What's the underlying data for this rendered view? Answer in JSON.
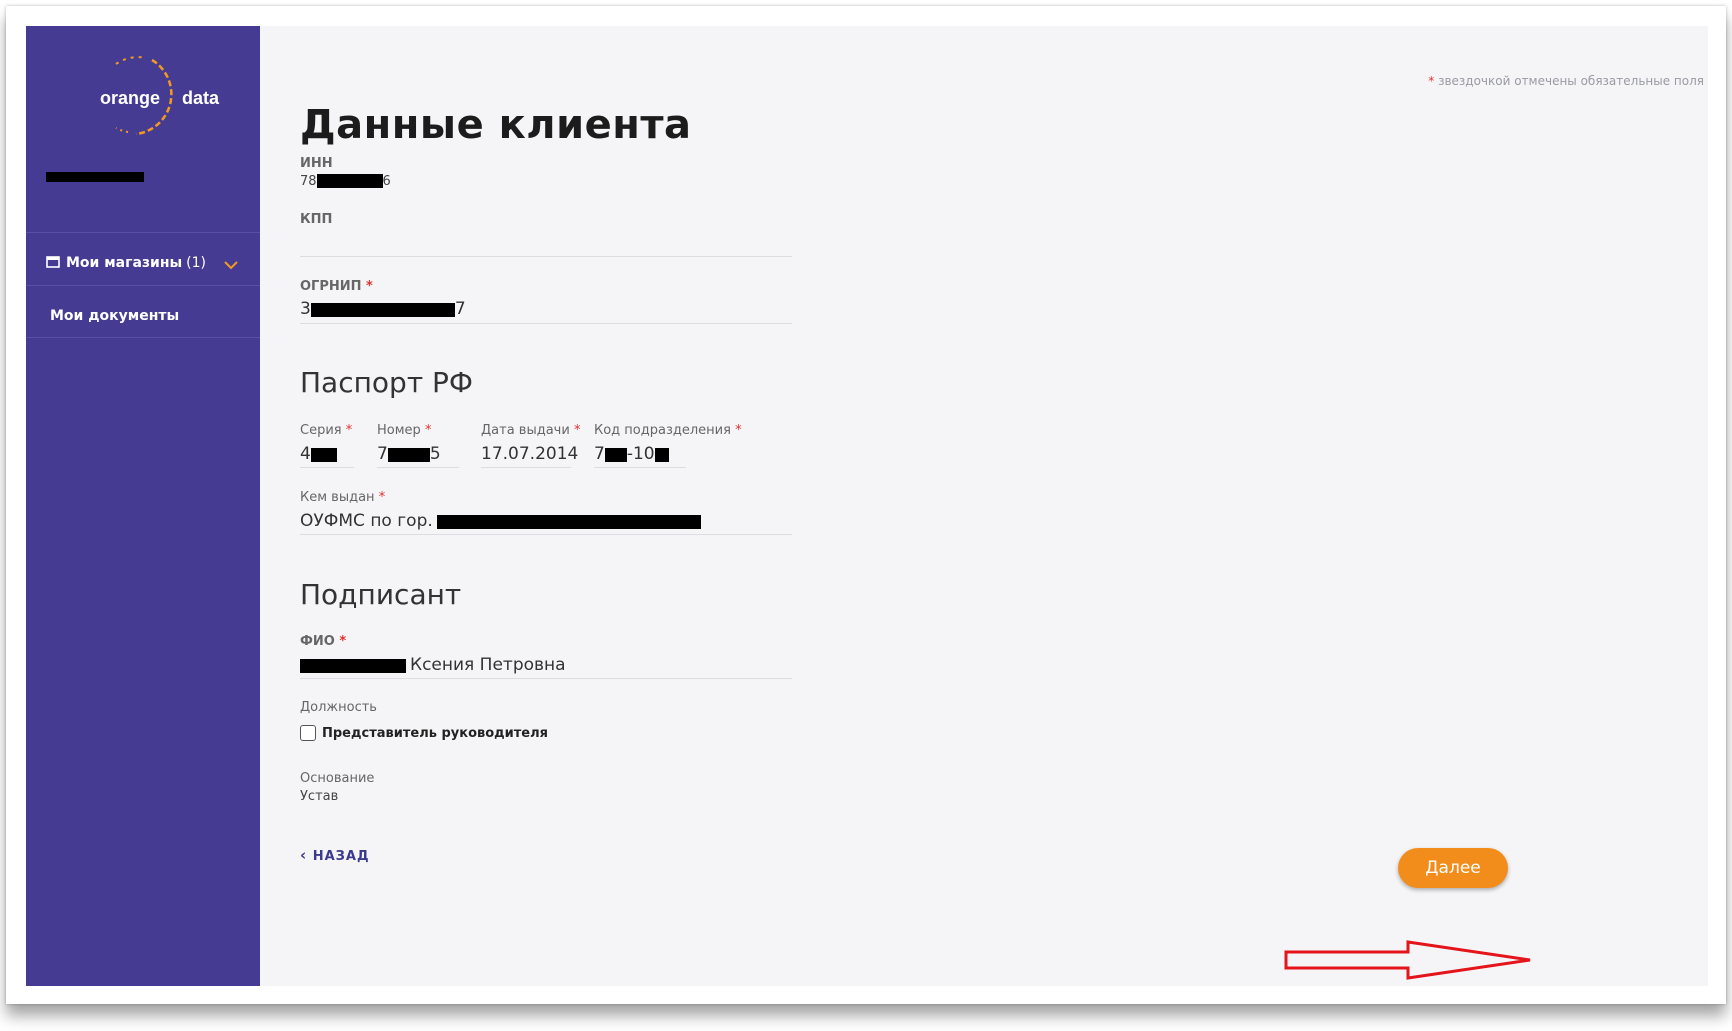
{
  "sidebar": {
    "logo_left": "orange",
    "logo_right": "data",
    "items": [
      {
        "label": "Мои магазины",
        "count": "(1)"
      },
      {
        "label": "Мои документы"
      }
    ]
  },
  "header": {
    "required_note": "звездочкой отмечены обязательные поля",
    "title": "Данные клиента"
  },
  "fields": {
    "inn": {
      "label": "ИНН",
      "value_prefix": "78",
      "value_suffix": "6"
    },
    "kpp": {
      "label": "КПП",
      "value": ""
    },
    "ogrnip": {
      "label": "ОГРНИП",
      "value_prefix": "3",
      "value_suffix": "7"
    }
  },
  "passport": {
    "section_title": "Паспорт РФ",
    "series": {
      "label": "Серия",
      "value_prefix": "4"
    },
    "number": {
      "label": "Номер",
      "value_prefix": "7",
      "value_suffix": "5"
    },
    "issue_date": {
      "label": "Дата выдачи",
      "value": "17.07.2014"
    },
    "division_code": {
      "label": "Код подразделения",
      "value_prefix": "7",
      "value_middle": "-10"
    },
    "issued_by": {
      "label": "Кем выдан",
      "value_prefix": "ОУФМС по гор."
    }
  },
  "signatory": {
    "section_title": "Подписант",
    "fio": {
      "label": "ФИО",
      "value_suffix": "Ксения Петровна"
    },
    "position": {
      "label": "Должность",
      "checkbox_label": "Представитель руководителя",
      "checked": false
    },
    "basis": {
      "label": "Основание",
      "value": "Устав"
    }
  },
  "footer": {
    "back_label": "НАЗАД",
    "next_label": "Далее"
  },
  "colors": {
    "sidebar": "#463b93",
    "accent": "#f28d1c",
    "required": "#e2312f",
    "annotation_arrow": "#e3141b"
  },
  "icons": {
    "store": "store-icon",
    "chevron": "chevron-down-icon",
    "back": "chevron-left-icon"
  }
}
